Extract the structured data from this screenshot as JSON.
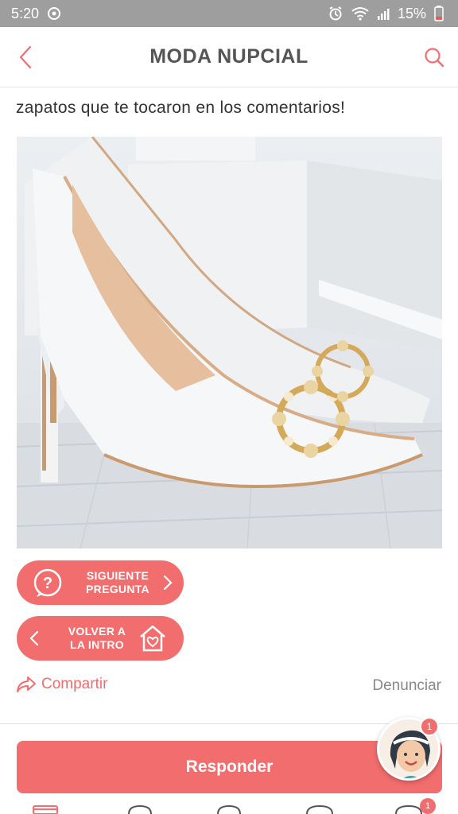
{
  "status_bar": {
    "time": "5:20",
    "battery": "15%",
    "icons": [
      "whatsapp-icon",
      "alarm-icon",
      "wifi-icon",
      "signal-icon",
      "battery-icon"
    ]
  },
  "header": {
    "title": "MODA NUPCIAL",
    "back_icon": "chevron-left-icon",
    "search_icon": "search-icon"
  },
  "post": {
    "text_line": "zapatos que te tocaron en los comentarios!",
    "image": "bridal-shoe-photo"
  },
  "actions": {
    "next_question": "SIGUIENTE\nPREGUNTA",
    "back_to_intro": "VOLVER A\nLA INTRO",
    "share": "Compartir",
    "report": "Denunciar",
    "reply": "Responder"
  },
  "badges": {
    "fab_count": "1",
    "nav_count": "1"
  },
  "colors": {
    "accent": "#f26d6d",
    "status_bar": "#9e9e9e"
  }
}
